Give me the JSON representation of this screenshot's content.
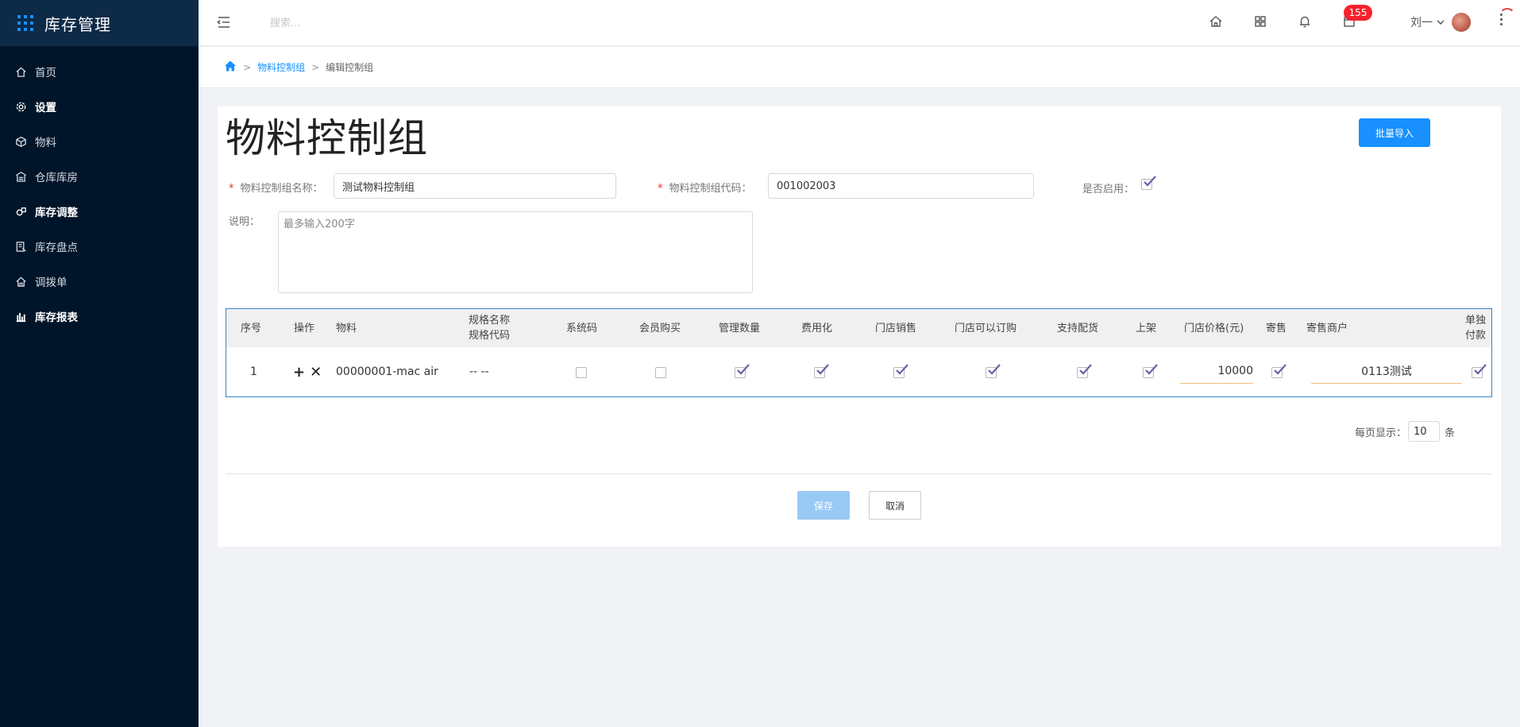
{
  "app": {
    "title": "库存管理"
  },
  "sidebar": {
    "items": [
      {
        "label": "首页",
        "icon": "home-icon"
      },
      {
        "label": "设置",
        "icon": "gear-icon"
      },
      {
        "label": "物料",
        "icon": "cube-icon"
      },
      {
        "label": "仓库库房",
        "icon": "warehouse-icon"
      },
      {
        "label": "库存调整",
        "icon": "adjust-icon"
      },
      {
        "label": "库存盘点",
        "icon": "inventory-icon"
      },
      {
        "label": "调拨单",
        "icon": "transfer-icon"
      },
      {
        "label": "库存报表",
        "icon": "bar-chart-icon"
      }
    ]
  },
  "header": {
    "search_placeholder": "搜索...",
    "notification_count": "155",
    "user_name": "刘一"
  },
  "breadcrumb": {
    "level1": "物料控制组",
    "level2": "编辑控制组"
  },
  "page": {
    "title": "物料控制组",
    "import_button": "批量导入"
  },
  "form": {
    "name_label": "物料控制组名称：",
    "name_value": "测试物料控制组",
    "code_label": "物料控制组代码：",
    "code_value": "001002003",
    "enabled_label": "是否启用：",
    "enabled": true,
    "desc_label": "说明：",
    "desc_placeholder": "最多输入200字"
  },
  "table": {
    "columns": {
      "index": "序号",
      "op": "操作",
      "material": "物料",
      "spec_name": "规格名称",
      "spec_code": "规格代码",
      "system_code": "系统码",
      "member_purchase": "会员购买",
      "manage_qty": "管理数量",
      "expense": "费用化",
      "store_sale": "门店销售",
      "store_order": "门店可以订购",
      "support_dist": "支持配货",
      "shelf": "上架",
      "store_price": "门店价格(元)",
      "consign": "寄售",
      "consign_merchant": "寄售商户",
      "separate_pay_1": "单独",
      "separate_pay_2": "付款"
    },
    "rows": [
      {
        "index": "1",
        "material": "00000001-mac air",
        "spec": "-- --",
        "system_code": false,
        "member_purchase": false,
        "manage_qty": true,
        "expense": true,
        "store_sale": true,
        "store_order": true,
        "support_dist": true,
        "shelf": true,
        "store_price": "10000",
        "consign": true,
        "consign_merchant": "0113测试",
        "separate_pay": true
      }
    ]
  },
  "pager": {
    "label": "每页显示：",
    "page_size": "10",
    "unit": "条"
  },
  "actions": {
    "save": "保存",
    "cancel": "取消"
  },
  "colors": {
    "sidebar_bg": "#001529",
    "primary": "#1890ff",
    "badge": "#f5222d",
    "check": "#6a5fa8"
  }
}
